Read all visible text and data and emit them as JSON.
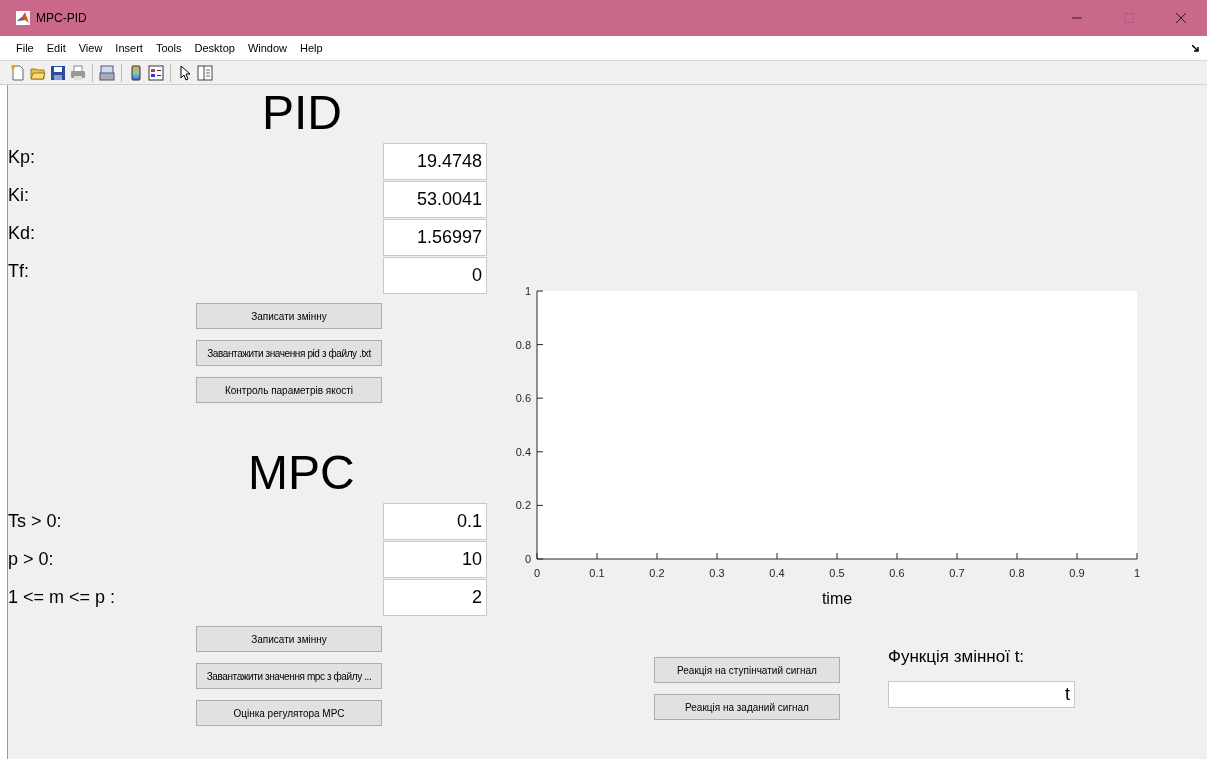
{
  "window": {
    "title": "MPC-PID"
  },
  "menu": [
    "File",
    "Edit",
    "View",
    "Insert",
    "Tools",
    "Desktop",
    "Window",
    "Help"
  ],
  "toolbar": [
    {
      "kind": "new"
    },
    {
      "kind": "open"
    },
    {
      "kind": "save"
    },
    {
      "kind": "print"
    },
    {
      "kind": "sep"
    },
    {
      "kind": "link"
    },
    {
      "kind": "sep"
    },
    {
      "kind": "colorbar"
    },
    {
      "kind": "legend"
    },
    {
      "kind": "sep"
    },
    {
      "kind": "pointer"
    },
    {
      "kind": "panel"
    }
  ],
  "pid": {
    "heading": "PID",
    "params": [
      {
        "label": "Kp:",
        "value": "19.4748"
      },
      {
        "label": "Ki:",
        "value": "53.0041"
      },
      {
        "label": "Kd:",
        "value": "1.56997"
      },
      {
        "label": "Tf:",
        "value": "0"
      }
    ],
    "buttons": [
      "Записати змінну",
      "Завантажити значення pid з файлу .txt",
      "Контроль параметрів якості"
    ]
  },
  "mpc": {
    "heading": "MPC",
    "params": [
      {
        "label": "Ts > 0:",
        "value": "0.1"
      },
      {
        "label": "p > 0:",
        "value": "10"
      },
      {
        "label": "1 <= m <= p :",
        "value": "2"
      }
    ],
    "buttons": [
      "Записати змінну",
      "Завантажити значення mpc з файлу ...",
      "Оцінка регулятора MPC"
    ]
  },
  "plot": {
    "chart_data": {
      "type": "line",
      "xlabel": "time",
      "xlim": [
        0,
        1
      ],
      "ylim": [
        0,
        1
      ],
      "xticks": [
        0,
        0.1,
        0.2,
        0.3,
        0.4,
        0.5,
        0.6,
        0.7,
        0.8,
        0.9,
        1
      ],
      "yticks": [
        0,
        0.2,
        0.4,
        0.6,
        0.8,
        1
      ]
    }
  },
  "response_buttons": [
    "Реакція на ступінчатий сигнал",
    "Реакція на заданий сигнал"
  ],
  "function": {
    "label": "Функція змінної t:",
    "value": "t"
  }
}
